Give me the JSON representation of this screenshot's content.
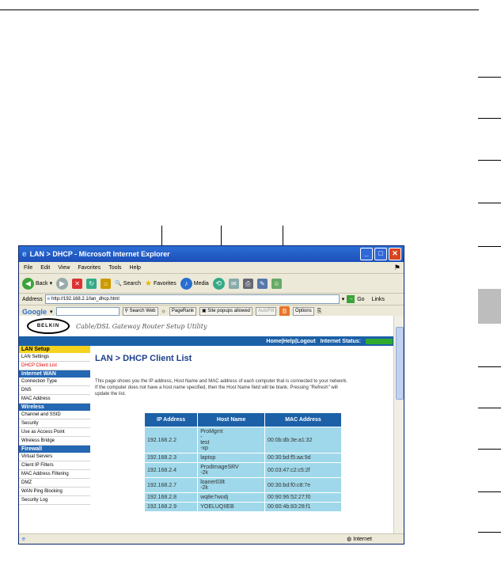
{
  "window": {
    "title": "LAN > DHCP - Microsoft Internet Explorer",
    "controls": [
      "_",
      "□",
      "✕"
    ]
  },
  "menu": [
    "File",
    "Edit",
    "View",
    "Favorites",
    "Tools",
    "Help"
  ],
  "toolbar": {
    "back": "Back",
    "search": "Search",
    "favorites": "Favorites",
    "media": "Media"
  },
  "address_bar": {
    "label": "Address",
    "url": "http://192.168.2.1/lan_dhcp.html",
    "go": "Go",
    "links": "Links"
  },
  "google_bar": {
    "logo": "Google",
    "search_web": "Search Web",
    "pagerank": "PageRank",
    "popups": "Site popups allowed",
    "autofill": "AutoFill",
    "options": "Options"
  },
  "router": {
    "brand": "BELKIN",
    "utility_title": "Cable/DSL Gateway Router Setup Utility",
    "nav": "Home|Help|Logout",
    "internet_status": "Internet Status:"
  },
  "sidebar": [
    {
      "type": "head",
      "label": "LAN Setup",
      "active": true
    },
    {
      "type": "item",
      "label": "LAN Settings"
    },
    {
      "type": "item",
      "label": "DHCP Client List",
      "active": true
    },
    {
      "type": "head",
      "label": "Internet WAN"
    },
    {
      "type": "item",
      "label": "Connection Type"
    },
    {
      "type": "item",
      "label": "DNS"
    },
    {
      "type": "item",
      "label": "MAC Address"
    },
    {
      "type": "head",
      "label": "Wireless"
    },
    {
      "type": "item",
      "label": "Channel and SSID"
    },
    {
      "type": "item",
      "label": "Security"
    },
    {
      "type": "item",
      "label": "Use as Access Point"
    },
    {
      "type": "item",
      "label": "Wireless Bridge"
    },
    {
      "type": "head",
      "label": "Firewall"
    },
    {
      "type": "item",
      "label": "Virtual Servers"
    },
    {
      "type": "item",
      "label": "Client IP Filters"
    },
    {
      "type": "item",
      "label": "MAC Address Filtering"
    },
    {
      "type": "item",
      "label": "DMZ"
    },
    {
      "type": "item",
      "label": "WAN Ping Blocking"
    },
    {
      "type": "item",
      "label": "Security Log"
    }
  ],
  "page": {
    "title": "LAN > DHCP Client List",
    "description": "This page shows you the IP address, Host Name and MAC address of each computer that is connected to your network. If the computer does not have a host name specified, then the Host Name field will be blank. Pressing \"Refresh\" will update the list."
  },
  "table": {
    "headers": [
      "IP Address",
      "Host Name",
      "MAC Address"
    ],
    "rows": [
      [
        "192.168.2.2",
        "ProMgmt\n-\ntest\n-xp",
        "00:0b:db:3e:a1:32"
      ],
      [
        "192.168.2.3",
        "laptop",
        "00:30:bd:f5:aa:9d"
      ],
      [
        "192.168.2.4",
        "ProdImageSRV\n-2k",
        "00:03:47:c2:c5:2f"
      ],
      [
        "192.168.2.7",
        "loaner03lt\n-2k",
        "00:30:bd:f0:c8:7e"
      ],
      [
        "192.168.2.8",
        "wq8e7wodj",
        "00:90:96:52:27:f0"
      ],
      [
        "192.168.2.9",
        "YOELUQIIEB",
        "00:60:4b:83:28:f1"
      ]
    ]
  },
  "statusbar": {
    "zone": "Internet"
  }
}
